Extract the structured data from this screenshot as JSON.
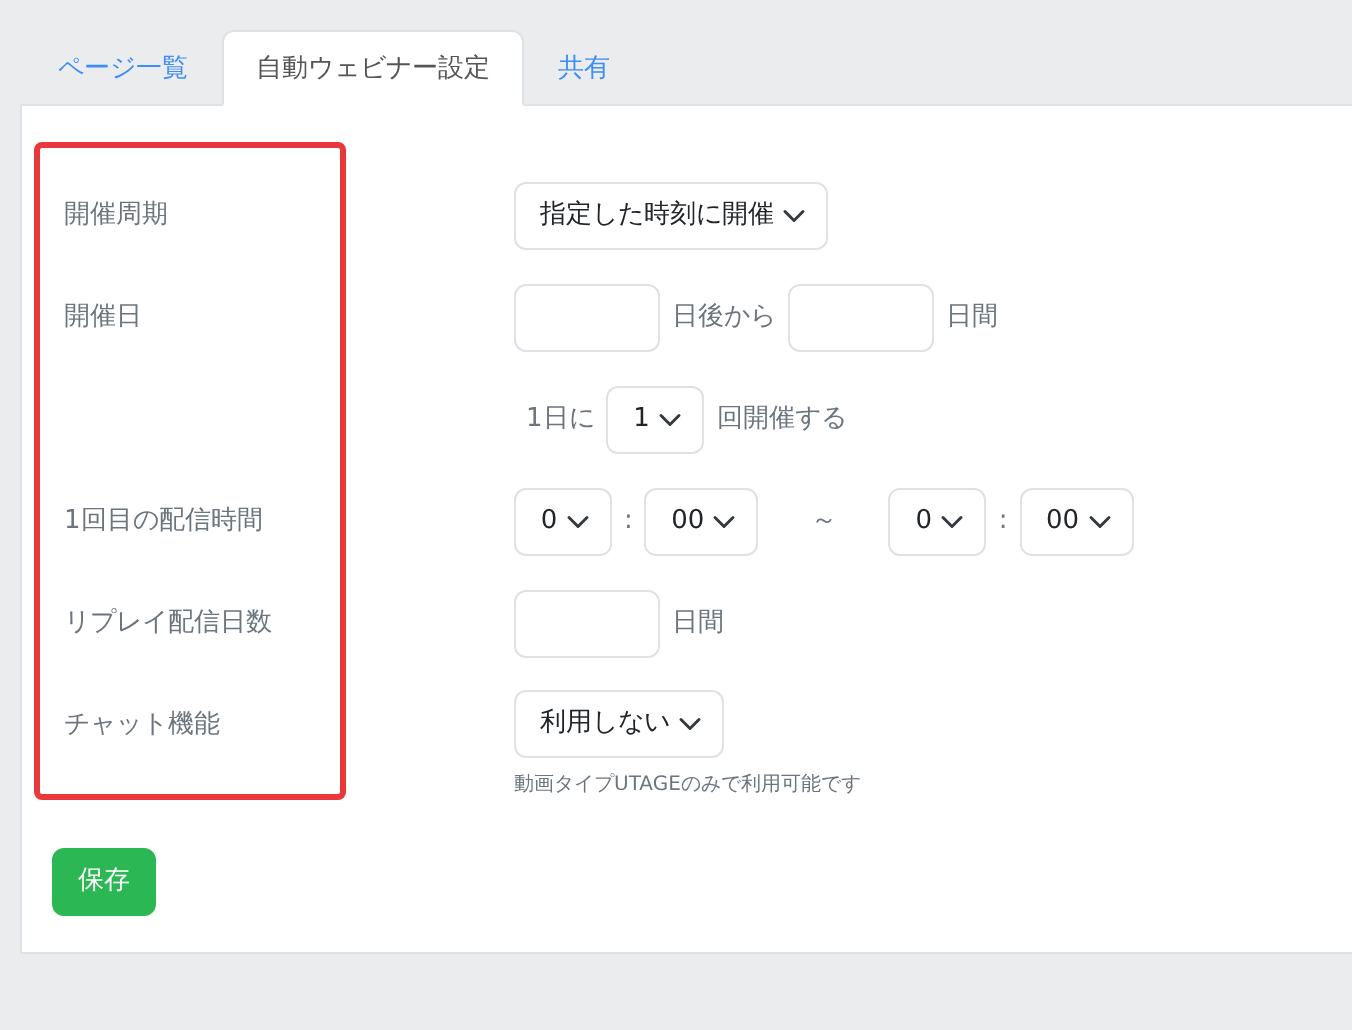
{
  "tabs": [
    {
      "label": "ページ一覧",
      "selected": false
    },
    {
      "label": "自動ウェビナー設定",
      "selected": true
    },
    {
      "label": "共有",
      "selected": false
    }
  ],
  "form": {
    "rows": [
      {
        "label": "開催周期",
        "controls": [
          {
            "kind": "select",
            "value": "指定した時刻に開催"
          }
        ]
      },
      {
        "label": "開催日",
        "controls": [
          {
            "kind": "input"
          },
          {
            "kind": "text",
            "text": "日後から"
          },
          {
            "kind": "input"
          },
          {
            "kind": "text",
            "text": "日間"
          }
        ]
      },
      {
        "controls": [
          {
            "kind": "text",
            "text": "1日に"
          },
          {
            "kind": "select",
            "value": "1"
          },
          {
            "kind": "text",
            "text": "回開催する"
          }
        ]
      },
      {
        "label": "1回目の配信時間",
        "controls": [
          {
            "kind": "select",
            "value": "0"
          },
          {
            "kind": "text",
            "text": ":"
          },
          {
            "kind": "select",
            "value": "00"
          },
          {
            "kind": "separator",
            "text": "～"
          },
          {
            "kind": "select",
            "value": "0"
          },
          {
            "kind": "text",
            "text": ":"
          },
          {
            "kind": "select",
            "value": "00"
          }
        ]
      },
      {
        "label": "リプレイ配信日数",
        "controls": [
          {
            "kind": "input"
          },
          {
            "kind": "text",
            "text": "日間"
          }
        ]
      },
      {
        "label": "チャット機能",
        "controls": [
          {
            "kind": "select",
            "value": "利用しない"
          }
        ],
        "note": "動画タイプUTAGEのみで利用可能です"
      }
    ]
  },
  "save_button": "保存"
}
